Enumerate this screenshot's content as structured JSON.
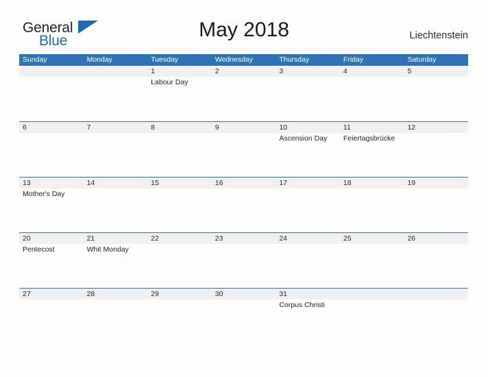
{
  "brand": {
    "name_part1": "General",
    "name_part2": "Blue",
    "flag_icon": "flag-triangle-icon",
    "color_primary": "#1f6bb0",
    "color_text": "#231f20"
  },
  "header": {
    "title": "May 2018",
    "region": "Liechtenstein"
  },
  "colors": {
    "header_blue": "#2e74b5",
    "band_gray": "#f0f0f0",
    "rule_blue": "#2e74b5",
    "page_bg": "#fdfdfd"
  },
  "calendar": {
    "weekdays": [
      "Sunday",
      "Monday",
      "Tuesday",
      "Wednesday",
      "Thursday",
      "Friday",
      "Saturday"
    ],
    "weeks": [
      {
        "days": [
          {
            "num": "",
            "events": []
          },
          {
            "num": "",
            "events": []
          },
          {
            "num": "1",
            "events": [
              "Labour Day"
            ]
          },
          {
            "num": "2",
            "events": []
          },
          {
            "num": "3",
            "events": []
          },
          {
            "num": "4",
            "events": []
          },
          {
            "num": "5",
            "events": []
          }
        ]
      },
      {
        "days": [
          {
            "num": "6",
            "events": []
          },
          {
            "num": "7",
            "events": []
          },
          {
            "num": "8",
            "events": []
          },
          {
            "num": "9",
            "events": []
          },
          {
            "num": "10",
            "events": [
              "Ascension Day"
            ]
          },
          {
            "num": "11",
            "events": [
              "Feiertagsbrücke"
            ]
          },
          {
            "num": "12",
            "events": []
          }
        ]
      },
      {
        "days": [
          {
            "num": "13",
            "events": [
              "Mother's Day"
            ]
          },
          {
            "num": "14",
            "events": []
          },
          {
            "num": "15",
            "events": []
          },
          {
            "num": "16",
            "events": []
          },
          {
            "num": "17",
            "events": []
          },
          {
            "num": "18",
            "events": []
          },
          {
            "num": "19",
            "events": []
          }
        ]
      },
      {
        "days": [
          {
            "num": "20",
            "events": [
              "Pentecost"
            ]
          },
          {
            "num": "21",
            "events": [
              "Whit Monday"
            ]
          },
          {
            "num": "22",
            "events": []
          },
          {
            "num": "23",
            "events": []
          },
          {
            "num": "24",
            "events": []
          },
          {
            "num": "25",
            "events": []
          },
          {
            "num": "26",
            "events": []
          }
        ]
      },
      {
        "days": [
          {
            "num": "27",
            "events": []
          },
          {
            "num": "28",
            "events": []
          },
          {
            "num": "29",
            "events": []
          },
          {
            "num": "30",
            "events": []
          },
          {
            "num": "31",
            "events": [
              "Corpus Christi"
            ]
          },
          {
            "num": "",
            "events": []
          },
          {
            "num": "",
            "events": []
          }
        ]
      }
    ]
  }
}
